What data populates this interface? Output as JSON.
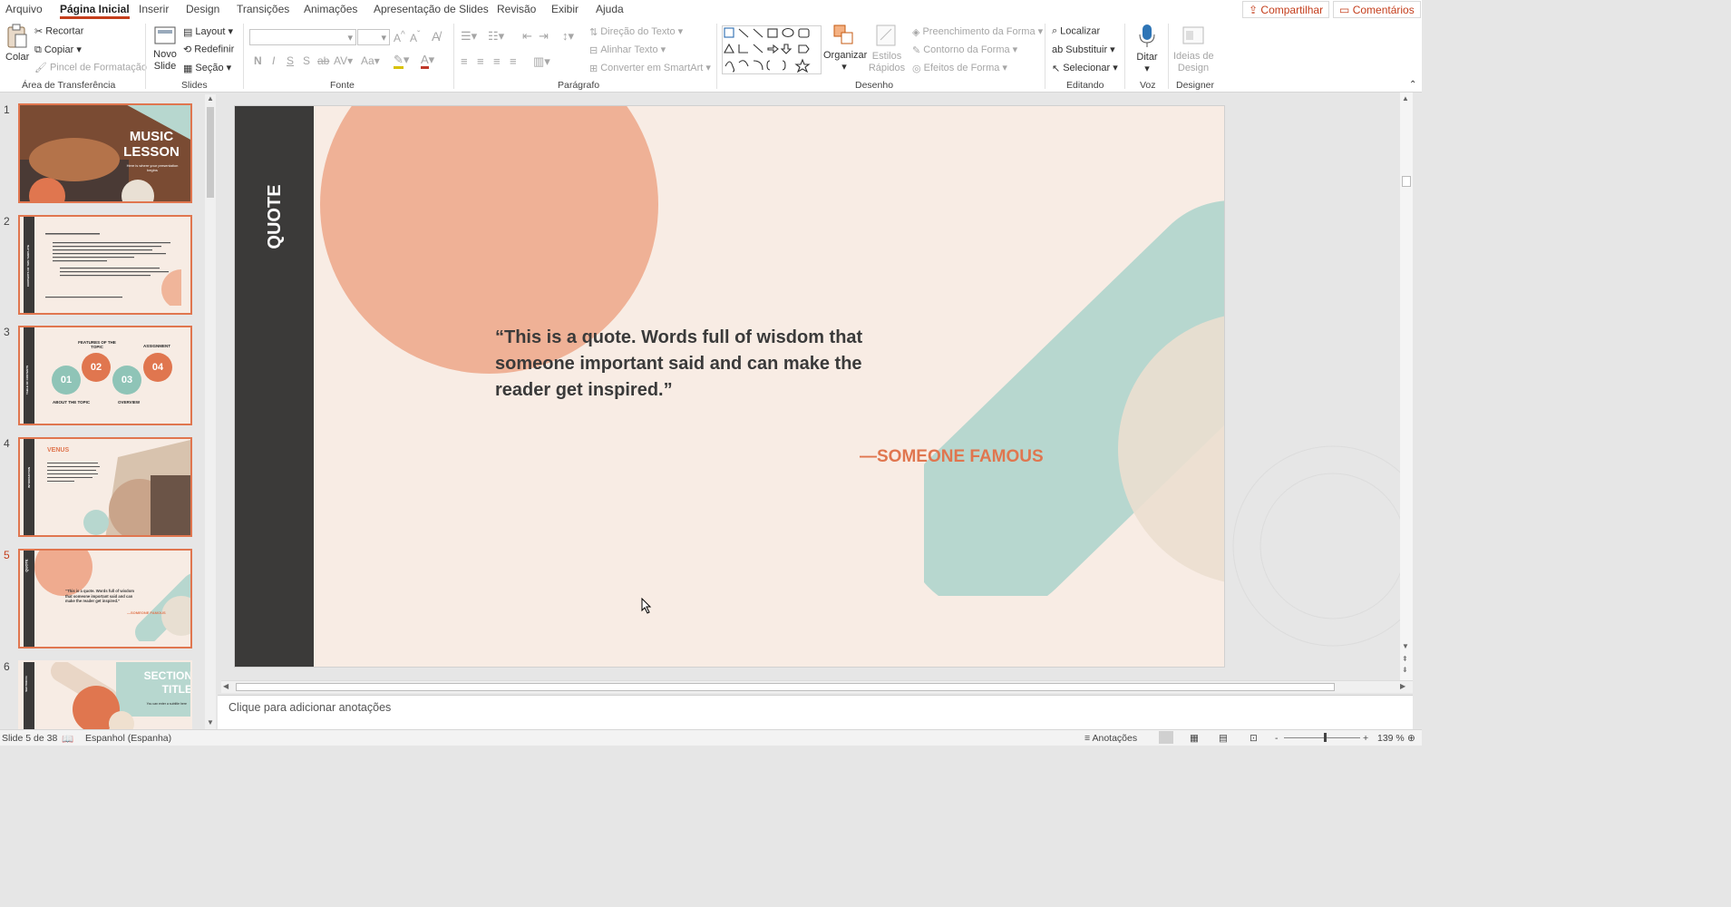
{
  "tabs": [
    "Arquivo",
    "Página Inicial",
    "Inserir",
    "Design",
    "Transições",
    "Animações",
    "Apresentação de Slides",
    "Revisão",
    "Exibir",
    "Ajuda"
  ],
  "top_actions": {
    "share": "Compartilhar",
    "comments": "Comentários"
  },
  "ribbon": {
    "clipboard": {
      "paste": "Colar",
      "cut": "Recortar",
      "copy": "Copiar",
      "format_painter": "Pincel de Formatação",
      "label": "Área de Transferência"
    },
    "slides": {
      "new_slide_1": "Novo",
      "new_slide_2": "Slide",
      "layout": "Layout",
      "reset": "Redefinir",
      "section": "Seção",
      "label": "Slides"
    },
    "font": {
      "bold": "N",
      "italic": "I",
      "underline": "S",
      "shadow": "S",
      "strike": "ab",
      "spacing": "AV",
      "case": "Aa",
      "font_color": "A",
      "label": "Fonte"
    },
    "paragraph": {
      "text_direction": "Direção do Texto",
      "align_text": "Alinhar Texto",
      "smartart": "Converter em SmartArt",
      "label": "Parágrafo"
    },
    "drawing": {
      "arrange": "Organizar",
      "quick_styles_1": "Estilos",
      "quick_styles_2": "Rápidos",
      "shape_fill": "Preenchimento da Forma",
      "shape_outline": "Contorno da Forma",
      "shape_effects": "Efeitos de Forma",
      "label": "Desenho"
    },
    "editing": {
      "find": "Localizar",
      "replace": "Substituir",
      "select": "Selecionar",
      "label": "Editando"
    },
    "voice": {
      "dictate": "Ditar",
      "label": "Voz"
    },
    "designer": {
      "ideas_1": "Ideias de",
      "ideas_2": "Design",
      "label": "Designer"
    }
  },
  "thumbnails": [
    {
      "num": "1",
      "title_1": "MUSIC",
      "title_2": "LESSON",
      "subtitle": "Here is where your presentation begins"
    },
    {
      "num": "2",
      "side": "CONTENTS OF THIS TEMPLATE"
    },
    {
      "num": "3",
      "side": "TABLE OF CONTENTS",
      "items": [
        {
          "n": "01",
          "label": "ABOUT THE TOPIC"
        },
        {
          "n": "02",
          "label": "FEATURES OF THE TOPIC"
        },
        {
          "n": "03",
          "label": "OVERVIEW"
        },
        {
          "n": "04",
          "label": "ASSIGNMENT"
        }
      ]
    },
    {
      "num": "4",
      "side": "INTRODUCTION",
      "heading": "VENUS"
    },
    {
      "num": "5",
      "side": "QUOTE",
      "quote": "“This is a quote. Words full of wisdom that someone important said and can make the reader get inspired.”",
      "author": "—SOMEONE FAMOUS"
    },
    {
      "num": "6",
      "side": "SECTION 01",
      "title_1": "SECTION",
      "title_2": "TITLE",
      "subtitle": "You can enter a subtitle here"
    }
  ],
  "slide": {
    "side_title": "QUOTE",
    "quote": "“This is a quote. Words full of wisdom that someone important said and can make the reader get inspired.”",
    "author": "—SOMEONE FAMOUS",
    "colors": {
      "background": "#f8ece4",
      "sidebar": "#3b3a39",
      "coral": "#e0764f",
      "teal": "#b7d7cf",
      "sand": "#efe0cf"
    }
  },
  "notes_placeholder": "Clique para adicionar anotações",
  "status": {
    "slide_of": "Slide 5 de 38",
    "language": "Espanhol (Espanha)",
    "notes": "Anotações",
    "zoom": "139 %",
    "zoom_minus": "-",
    "zoom_plus": "+"
  }
}
